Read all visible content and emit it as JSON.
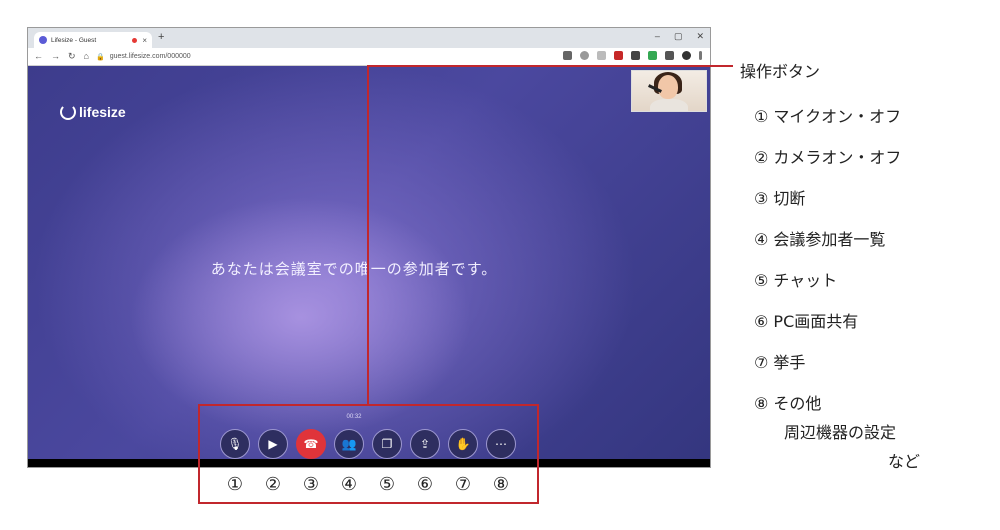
{
  "browser": {
    "tab_title": "Lifesize - Guest",
    "tab_close": "×",
    "new_tab": "+",
    "url": "guest.lifesize.com/000000",
    "window_controls": [
      "–",
      "▢",
      "✕"
    ]
  },
  "stage": {
    "logo_text": "lifesize",
    "message": "あなたは会議室での唯一の参加者です。",
    "timer": "00:32"
  },
  "controls": [
    {
      "icon": "microphone-icon",
      "glyph": "🎙"
    },
    {
      "icon": "camera-icon",
      "glyph": "▶"
    },
    {
      "icon": "hang-up-icon",
      "glyph": "☎"
    },
    {
      "icon": "participants-icon",
      "glyph": "👥"
    },
    {
      "icon": "chat-icon",
      "glyph": "❐"
    },
    {
      "icon": "share-screen-icon",
      "glyph": "⇪"
    },
    {
      "icon": "raise-hand-icon",
      "glyph": "✋"
    },
    {
      "icon": "more-icon",
      "glyph": "⋯"
    }
  ],
  "callout_numbers": [
    "①",
    "②",
    "③",
    "④",
    "⑤",
    "⑥",
    "⑦",
    "⑧"
  ],
  "legend": {
    "title": "操作ボタン",
    "items": [
      "① マイクオン・オフ",
      "② カメラオン・オフ",
      "③ 切断",
      "④ 会議参加者一覧",
      "⑤ チャット",
      "⑥ PC画面共有",
      "⑦ 挙手",
      "⑧ その他"
    ],
    "item8_line2": "周辺機器の設定",
    "item8_line3": "など"
  },
  "colors": {
    "accent_red": "#c1272d",
    "hang_up": "#e0343a",
    "stage_purple": "#4b489f"
  }
}
